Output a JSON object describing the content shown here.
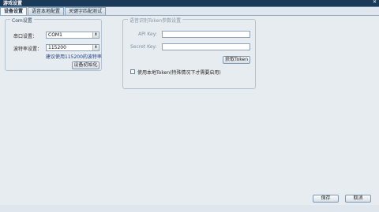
{
  "window": {
    "title": "游戏设置",
    "close_glyph": "✕"
  },
  "tabs": [
    {
      "label": "设备设置",
      "active": true
    },
    {
      "label": "语音本地配置",
      "active": false
    },
    {
      "label": "关键字匹配测试",
      "active": false
    }
  ],
  "com_group": {
    "legend": "Com设置",
    "port_label": "串口设置：",
    "port_value": "COM1",
    "baud_label": "波特率设置：",
    "baud_value": "115200",
    "hint": "建议使用115200的波特率",
    "init_button": "设备初始化"
  },
  "token_group": {
    "legend": "语音识别Token参数设置",
    "api_key_label": "API Key:",
    "api_key_value": "",
    "secret_key_label": "Secret Key:",
    "secret_key_value": "",
    "get_token_button": "获取Token",
    "local_token_checkbox": "使用本地Token(特殊情况下才需要启用)",
    "local_token_checked": false
  },
  "footer": {
    "save_button": "保存",
    "cancel_button": "取消"
  },
  "colors": {
    "background": "#e7ecf1",
    "accent": "#1f3c88",
    "titlebar": "#1b3a5a"
  }
}
